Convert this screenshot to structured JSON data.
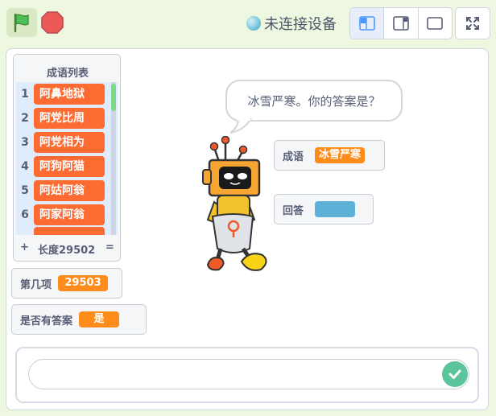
{
  "topbar": {
    "green_flag_icon": "green-flag-icon",
    "stop_icon": "stop-icon",
    "device_status": "未连接设备",
    "layout_buttons": [
      "small-stage",
      "stage-and-sidebar",
      "large-stage"
    ],
    "fullscreen_icon": "fullscreen-icon"
  },
  "list_monitor": {
    "title": "成语列表",
    "items": [
      {
        "index": "1",
        "value": "阿鼻地狱"
      },
      {
        "index": "2",
        "value": "阿党比周"
      },
      {
        "index": "3",
        "value": "阿党相为"
      },
      {
        "index": "4",
        "value": "阿狗阿猫"
      },
      {
        "index": "5",
        "value": "阿姑阿翁"
      },
      {
        "index": "6",
        "value": "阿家阿翁"
      }
    ],
    "add_symbol": "+",
    "length_text": "长度29502",
    "resize_symbol": "="
  },
  "monitors": {
    "nth_item": {
      "label": "第几项",
      "value": "29503"
    },
    "has_answer": {
      "label": "是否有答案",
      "value": "是"
    },
    "idiom": {
      "label": "成语",
      "value": "冰雪严寒"
    },
    "answer": {
      "label": "回答",
      "value": ""
    }
  },
  "speech": {
    "text": "冰雪严寒。你的答案是？"
  },
  "ask": {
    "input_value": "",
    "submit_icon": "check-icon"
  },
  "colors": {
    "list_item": "#fc6b32",
    "variable": "#ff8c1a",
    "answer": "#5cb1d6",
    "submit": "#5cc49a",
    "background": "#eef8e0"
  }
}
